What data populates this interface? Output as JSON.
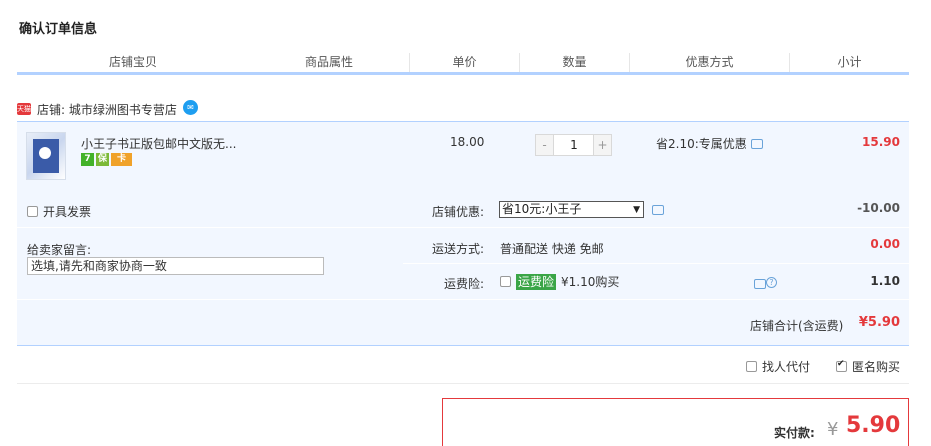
{
  "page_title": "确认订单信息",
  "columns": [
    "店铺宝贝",
    "商品属性",
    "单价",
    "数量",
    "优惠方式",
    "小计"
  ],
  "shop": {
    "badge": "天猫",
    "label": "店铺: 城市绿洲图书专营店"
  },
  "item": {
    "title": "小王子书正版包邮中文版无...",
    "service_icons": [
      "7",
      "保",
      "卡"
    ],
    "unit_price": "18.00",
    "quantity": "1",
    "qty_minus": "-",
    "qty_plus": "+",
    "promotion": "省2.10:专属优惠",
    "subtotal": "15.90"
  },
  "invoice_label": "开具发票",
  "memo": {
    "label": "给卖家留言:",
    "placeholder": "选填,请先和商家协商一致"
  },
  "shop_discount": {
    "label": "店铺优惠:",
    "selected": "省10元:小王子",
    "value": "-10.00"
  },
  "shipping": {
    "label": "运送方式:",
    "value": "普通配送 快递 免邮",
    "fee": "0.00"
  },
  "insurance": {
    "label": "运费险:",
    "tag": "运费险",
    "price_text": "¥1.10购买",
    "value": "1.10"
  },
  "shop_total": {
    "label": "店铺合计(含运费)",
    "value": "¥5.90"
  },
  "agent_pay_label": "找人代付",
  "anonymous_label": "匿名购买",
  "anonymous_checked": true,
  "payment": {
    "label": "实付款:",
    "currency": "¥",
    "amount": "5.90"
  },
  "colors": {
    "accent_red": "#e4393c",
    "row_blue": "#f2f7ff",
    "border_blue": "#b2d1ff"
  }
}
